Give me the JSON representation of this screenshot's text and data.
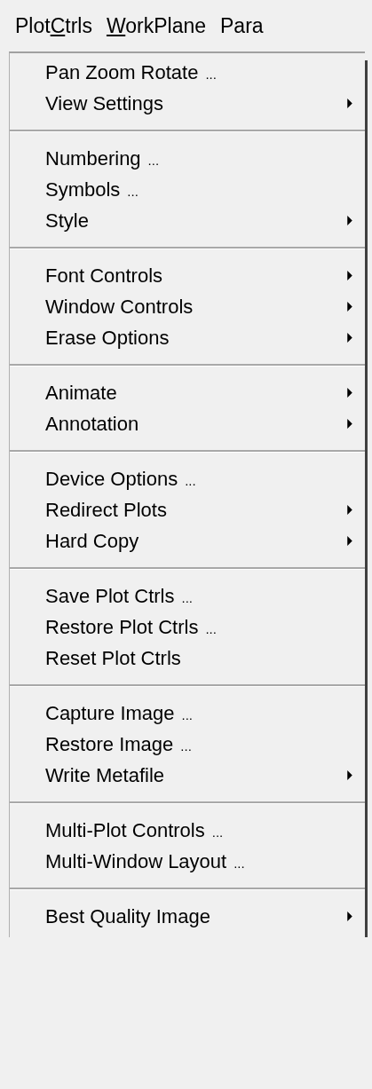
{
  "menu_bar": [
    {
      "before": "Plot",
      "access_key": "C",
      "after": "trls"
    },
    {
      "access_key": "W",
      "after": "orkPlane"
    },
    {
      "before": "Para"
    }
  ],
  "menu": {
    "groups": [
      {
        "items": [
          {
            "label": "Pan Zoom Rotate",
            "ellipsis": "...",
            "submenu": false
          },
          {
            "label": "View Settings",
            "submenu": true
          }
        ]
      },
      {
        "items": [
          {
            "label": "Numbering",
            "ellipsis": "...",
            "submenu": false
          },
          {
            "label": "Symbols",
            "ellipsis": "...",
            "submenu": false
          },
          {
            "label": "Style",
            "submenu": true
          }
        ]
      },
      {
        "items": [
          {
            "label": "Font Controls",
            "submenu": true
          },
          {
            "label": "Window Controls",
            "submenu": true
          },
          {
            "label": "Erase Options",
            "submenu": true
          }
        ]
      },
      {
        "items": [
          {
            "label": "Animate",
            "submenu": true
          },
          {
            "label": "Annotation",
            "submenu": true
          }
        ]
      },
      {
        "items": [
          {
            "label": "Device Options",
            "ellipsis": "...",
            "submenu": false
          },
          {
            "label": "Redirect Plots",
            "submenu": true
          },
          {
            "label": "Hard Copy",
            "submenu": true
          }
        ]
      },
      {
        "items": [
          {
            "label": "Save Plot Ctrls",
            "ellipsis": "...",
            "submenu": false
          },
          {
            "label": "Restore Plot Ctrls",
            "ellipsis": "...",
            "submenu": false
          },
          {
            "label": "Reset Plot Ctrls",
            "submenu": false
          }
        ]
      },
      {
        "items": [
          {
            "label": "Capture Image",
            "ellipsis": "...",
            "submenu": false
          },
          {
            "label": "Restore Image",
            "ellipsis": "...",
            "submenu": false
          },
          {
            "label": "Write Metafile",
            "submenu": true
          }
        ]
      },
      {
        "items": [
          {
            "label": "Multi-Plot Controls",
            "ellipsis": "...",
            "submenu": false
          },
          {
            "label": "Multi-Window Layout",
            "ellipsis": "...",
            "submenu": false
          }
        ]
      },
      {
        "items": [
          {
            "label": "Best Quality Image",
            "submenu": true
          }
        ]
      }
    ]
  }
}
